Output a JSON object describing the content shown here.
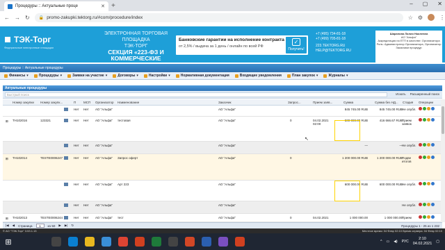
{
  "browser": {
    "tab_title": "Процедуры :: Актуальные проце",
    "url": "promo-zakupki.tektorg.ru/#com/procedure/index"
  },
  "banner": {
    "logo": "ТЭК-Торг",
    "logo_sub": "Федеральные электронные площадки",
    "etp_line1": "ЭЛЕКТРОННАЯ ТОРГОВАЯ ПЛОЩАДКА",
    "etp_line2": "ТЭК-ТОРГ",
    "etp_line3": "СЕКЦИЯ «223-ФЗ И КОММЕРЧЕСКИЕ",
    "etp_line4": "ЗАКУПКИ»",
    "guarantee_title": "Банковские гарантии на исполнение контракта",
    "guarantee_sub": "от 2,5% / выдача за 1 день / онлайн по всей РФ",
    "guarantee_btn": "Получить!",
    "phone1": "+7 (495) 734-81-18",
    "phone2": "+7 (499) 705-81-18",
    "site": "223.TEKTORG.RU",
    "email": "HELP@TEKTORG.RU",
    "user_name": "Шарапова Лилия Наилевна",
    "user_org": "АО \"Альфа\"",
    "user_role1": "Аккредитация на ЕТП в качестве: Организатора",
    "user_role2": "Роль: Администратор Организатора, Организатор",
    "user_role3": "Заказчики процедур"
  },
  "nav": {
    "breadcrumb": "Процедуры :: Актуальные процедуры"
  },
  "toolbar": {
    "items": [
      "Финансы",
      "Процедуры",
      "Заявки на участие",
      "Договоры",
      "Настройки",
      "Нормативная документация",
      "Входящие уведомления",
      "План закупок",
      "Журналы"
    ]
  },
  "panel": {
    "title": "Актуальные процедуры",
    "search_placeholder": "Быстрый поиск",
    "search_btn": "Искать",
    "advanced_btn": "Расширенный поиск"
  },
  "table": {
    "headers": [
      "Номер закупки",
      "Номер закупк...",
      "",
      "П",
      "МСП",
      "Организатор",
      "Наименование",
      "Заказчик",
      "Запрос...",
      "Прием заяв...",
      "Сумма",
      "Сумма без НД...",
      "Стадия",
      "Операции"
    ],
    "rows": [
      {
        "num": "",
        "num2": "",
        "p": "Нет",
        "msp": "Нет",
        "org": "АО \"Альфа\"",
        "name": "",
        "cust": "АО \"Альфа\"",
        "req": "",
        "date": "",
        "sum": "845 745.00 RUB",
        "sum2": "845 745.00 RUB",
        "stage": "Не опубл."
      },
      {
        "num": "TH102016",
        "num2": "123321",
        "p": "Нет",
        "msp": "Нет",
        "org": "АО \"Альфа\"",
        "name": "тестовая",
        "cust": "АО \"Альфа\"",
        "req": "0",
        "date": "04.02.2021 02:00",
        "sum": "500 000.00 RUB",
        "sum2": "416 666.67 RUB",
        "stage": "Прием заявок"
      },
      {
        "num": "",
        "num2": "",
        "p": "Нет",
        "msp": "Нет",
        "org": "АО \"Альфа\"",
        "name": "",
        "cust": "АО \"Альфа\"",
        "req": "",
        "date": "",
        "sum": "—",
        "sum2": "—",
        "stage": "Не опубл."
      },
      {
        "num": "TH102014",
        "num2": "TESTE0006247",
        "p": "Нет",
        "msp": "Нет",
        "org": "АО \"Альфа\"",
        "name": "Запрос оферт",
        "cust": "АО \"Альфа\"",
        "req": "0",
        "date": "",
        "sum": "1 200 000.00 RUB",
        "sum2": "1 200 000.00 RUB",
        "stage": "Подве итогов"
      },
      {
        "num": "",
        "num2": "",
        "p": "Нет",
        "msp": "Нет",
        "org": "АО \"Альфа\"",
        "name": "Арт 223",
        "cust": "АО \"Альфа\"",
        "req": "",
        "date": "",
        "sum": "600 000.00 RUB",
        "sum2": "600 000.00 RUB",
        "stage": "Не опубл."
      },
      {
        "num": "",
        "num2": "",
        "p": "Нет",
        "msp": "Нет",
        "org": "АО \"Альфа\"",
        "name": "",
        "cust": "АО \"Альфа\"",
        "req": "",
        "date": "",
        "sum": "",
        "sum2": "",
        "stage": "Не опубл."
      },
      {
        "num": "TH102013",
        "num2": "TESTE0006244",
        "p": "Нет",
        "msp": "Нет",
        "org": "АО \"Альфа\"",
        "name": "тест",
        "cust": "АО \"Альфа\"",
        "req": "0",
        "date": "04.02.2021",
        "sum": "1 000 000.00",
        "sum2": "1 000 000.00",
        "stage": "Прием"
      }
    ]
  },
  "footer": {
    "page_label": "Страница",
    "page_value": "1",
    "page_of": "из 50",
    "records": "Процедуры 1 - 25 из 1 232"
  },
  "status": {
    "left": "© АО \"ТЭК-Торг\" 3.53.1.13",
    "right": "Местное время: 04 Февр 02:10   Время сервера: 04 Февр 02:10"
  },
  "taskbar": {
    "lang": "РУС",
    "time": "2:10",
    "date": "04.02.2021"
  }
}
